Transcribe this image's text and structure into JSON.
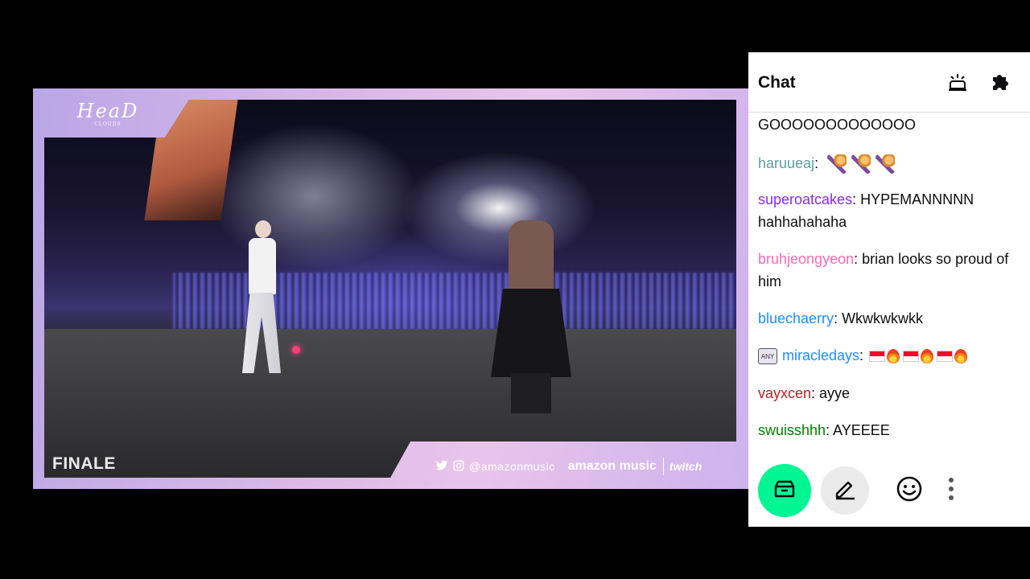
{
  "video": {
    "logo_main": "HeaD",
    "logo_sub": "CLOUDS",
    "segment_label": "FINALE",
    "social_handle": "@amazonmusic",
    "brand_amazon": "amazon music",
    "brand_twitch": "twitch",
    "icons": [
      "twitter-icon",
      "instagram-icon"
    ]
  },
  "chat": {
    "title": "Chat",
    "header_icons": [
      "highlight-icon",
      "extensions-icon"
    ],
    "messages": [
      {
        "user": "",
        "text": "GOOOOOOOOOOOOO",
        "user_color": "#0e0e10"
      },
      {
        "user": "haruueaj",
        "text": ":",
        "user_color": "#5f9ea0",
        "emotes": [
          "mic-emote",
          "mic-emote",
          "mic-emote"
        ]
      },
      {
        "user": "superoatcakes",
        "text": ": HYPEMANNNNN hahhahahaha",
        "user_color": "#8a2be2"
      },
      {
        "user": "bruhjeongyeon",
        "text": ": brian looks so proud of him",
        "user_color": "#ff69b4"
      },
      {
        "user": "bluechaerry",
        "text": ": Wkwkwkwkk",
        "user_color": "#1e90ff"
      },
      {
        "user": "miracledays",
        "text": ":",
        "user_color": "#1e90ff",
        "badge": "ANY",
        "emotes": [
          "flag",
          "fire",
          "flag",
          "fire",
          "flag",
          "fire"
        ]
      },
      {
        "user": "vayxcen",
        "text": ": ayye",
        "user_color": "#b22222"
      },
      {
        "user": "swuisshhh",
        "text": ": AYEEEE",
        "user_color": "#008000"
      }
    ],
    "footer_icons": [
      "drops-icon",
      "edit-icon",
      "emote-icon",
      "more-icon"
    ],
    "colors": {
      "drops_button": "#00f593"
    }
  }
}
